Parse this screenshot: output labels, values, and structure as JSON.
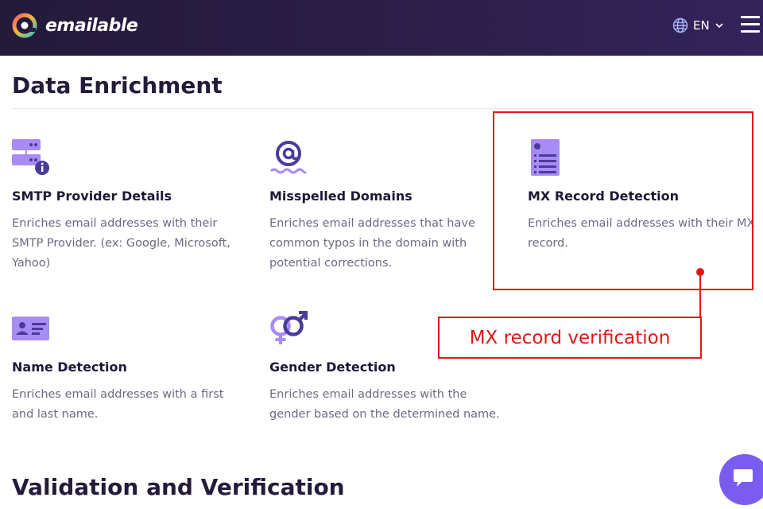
{
  "header": {
    "brand": "emailable",
    "language": "EN"
  },
  "enrichment": {
    "title": "Data Enrichment",
    "features": [
      {
        "title": "SMTP Provider Details",
        "desc": "Enriches email addresses with their SMTP Provider. (ex: Google, Microsoft, Yahoo)",
        "icon": "server-info-icon"
      },
      {
        "title": "Misspelled Domains",
        "desc": "Enriches email addresses that have common typos in the domain with potential corrections.",
        "icon": "at-sign-icon"
      },
      {
        "title": "MX Record Detection",
        "desc": "Enriches email addresses with their MX record.",
        "icon": "document-list-icon"
      },
      {
        "title": "Name Detection",
        "desc": "Enriches email addresses with a first and last name.",
        "icon": "id-card-icon"
      },
      {
        "title": "Gender Detection",
        "desc": "Enriches email addresses with the gender based on the determined name.",
        "icon": "gender-icon"
      }
    ]
  },
  "annotation": {
    "label": "MX record verification"
  },
  "validation": {
    "title": "Validation and Verification"
  },
  "colors": {
    "header_bg": "#2c1f4a",
    "icon_purple": "#a88cf5",
    "icon_dark": "#4b3a9a",
    "annotation_red": "#e01818",
    "chat_purple": "#7b5cf0"
  }
}
